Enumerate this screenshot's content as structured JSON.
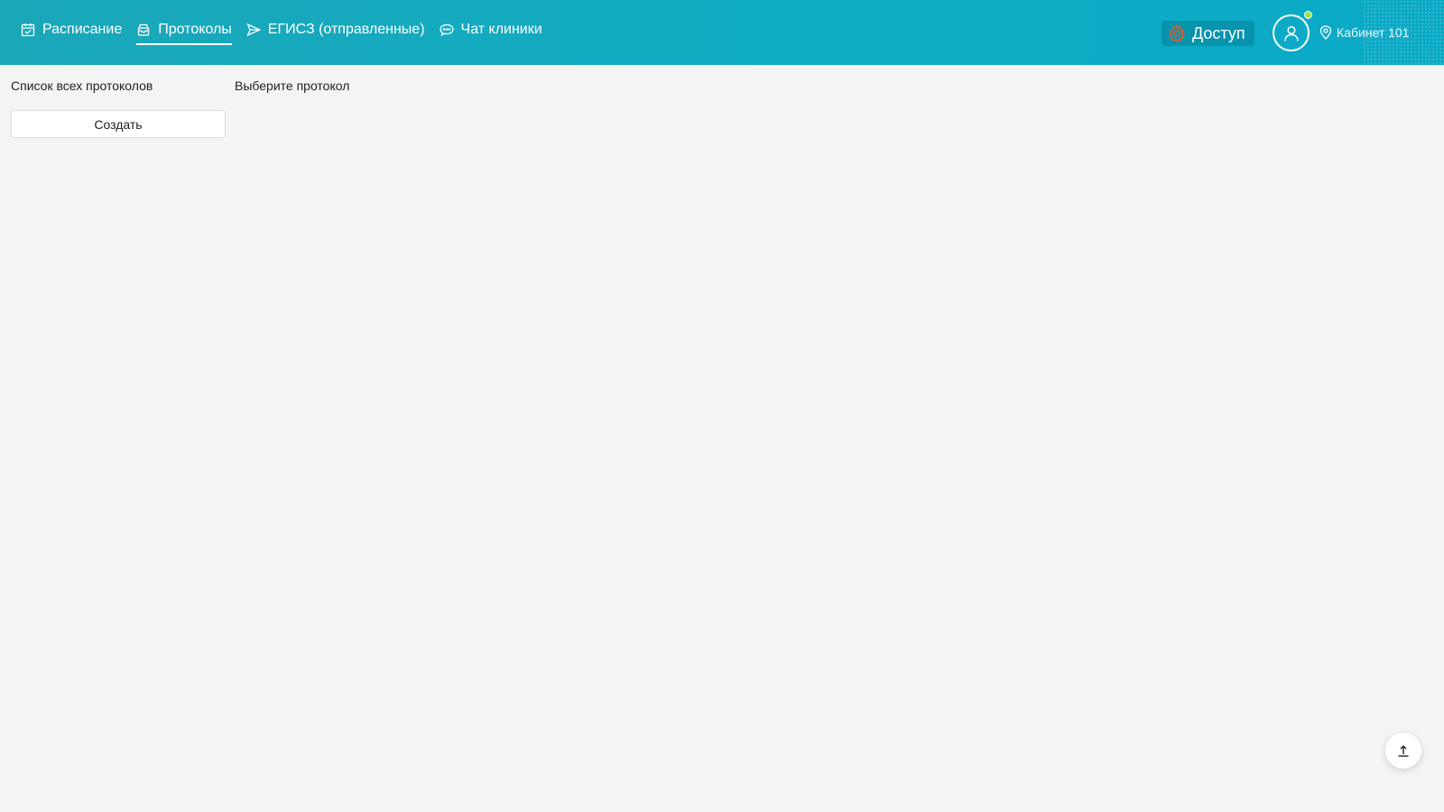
{
  "header": {
    "nav": [
      {
        "label": "Расписание",
        "icon": "calendar-icon",
        "active": false
      },
      {
        "label": "Протоколы",
        "icon": "inbox-icon",
        "active": true
      },
      {
        "label": "ЕГИСЗ (отправленные)",
        "icon": "send-icon",
        "active": false
      },
      {
        "label": "Чат клиники",
        "icon": "chat-icon",
        "active": false
      }
    ],
    "access_label": "Доступ",
    "access_icon": "gear-icon",
    "cabinet_label": "Кабинет 101",
    "cabinet_icon": "location-pin-icon",
    "status_color": "#9be24a"
  },
  "sidebar": {
    "title": "Список всех протоколов",
    "create_label": "Создать"
  },
  "main": {
    "hint": "Выберите протокол"
  },
  "colors": {
    "header_bg": "#10acc4",
    "page_bg": "#f4f4f4",
    "access_icon_color": "#e05a2a"
  }
}
